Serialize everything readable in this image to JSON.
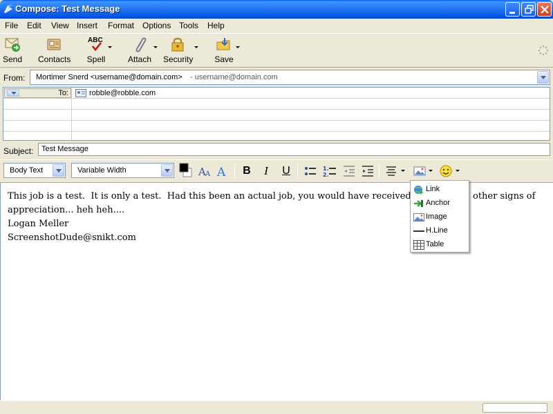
{
  "window": {
    "title": "Compose: Test Message"
  },
  "menubar": {
    "items": [
      {
        "label": "File"
      },
      {
        "label": "Edit"
      },
      {
        "label": "View"
      },
      {
        "label": "Insert"
      },
      {
        "label": "Format"
      },
      {
        "label": "Options"
      },
      {
        "label": "Tools"
      },
      {
        "label": "Help"
      }
    ]
  },
  "toolbar": {
    "send": "Send",
    "contacts": "Contacts",
    "spell": "Spell",
    "spell_icon_text": "ABC",
    "attach": "Attach",
    "security": "Security",
    "save": "Save"
  },
  "header": {
    "from_label": "From:",
    "from_value": "Mortimer Snerd <username@domain.com>",
    "from_account": "- username@domain.com",
    "to_label": "To:",
    "to_value": "robble@robble.com",
    "subject_label": "Subject:",
    "subject_value": "Test Message"
  },
  "format_toolbar": {
    "paragraph_style": "Body Text",
    "font": "Variable Width",
    "bold": "B",
    "italic": "I",
    "underline": "U",
    "text_color": "#000000"
  },
  "editor": {
    "lines": [
      "This job is a test.  It is only a test.  Had this been an actual job, you would have received raises, p",
      "appreciation... heh heh....",
      "",
      "",
      "Logan Meller",
      "ScreenshotDude@snikt.com"
    ],
    "line1_tail": "other signs of"
  },
  "insert_menu": {
    "items": [
      {
        "label": "Link",
        "icon": "link-icon"
      },
      {
        "label": "Anchor",
        "icon": "anchor-icon"
      },
      {
        "label": "Image",
        "icon": "image-icon"
      },
      {
        "label": "H.Line",
        "icon": "hline-icon"
      },
      {
        "label": "Table",
        "icon": "table-icon"
      }
    ]
  }
}
